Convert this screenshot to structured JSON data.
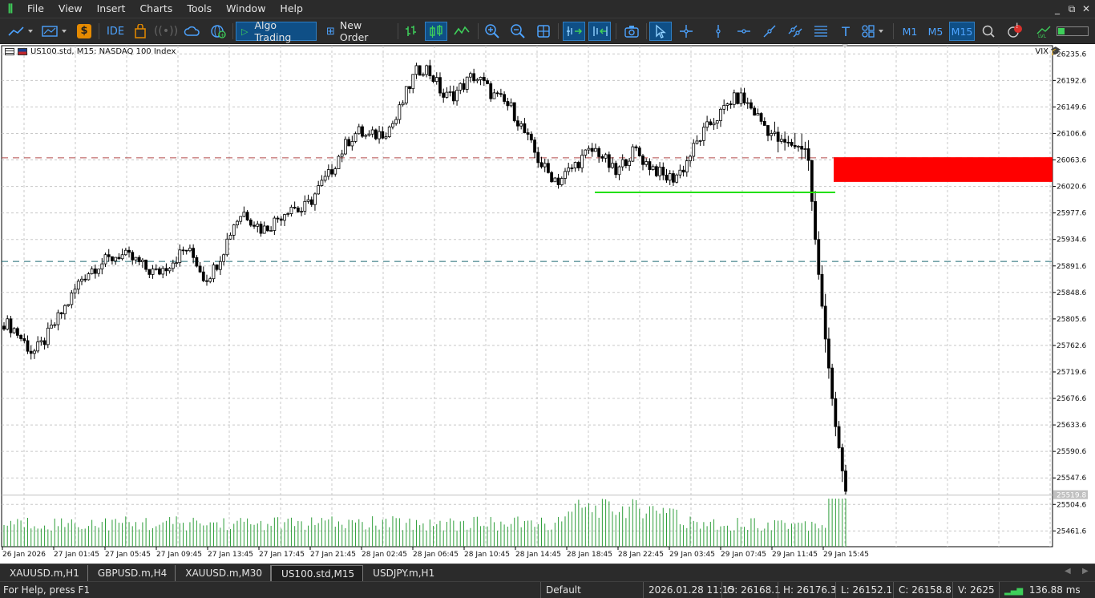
{
  "app": {
    "menu": [
      "File",
      "View",
      "Insert",
      "Charts",
      "Tools",
      "Window",
      "Help"
    ],
    "window_controls": [
      "_",
      "⧉",
      "✕"
    ]
  },
  "toolbar": {
    "ide_label": "IDE",
    "algo_trading_label": "Algo Trading",
    "new_order_label": "New Order",
    "timeframes": [
      "M1",
      "M5",
      "M15"
    ],
    "active_timeframe": "M15",
    "notification_badge": "!"
  },
  "chart_header": {
    "symbol_text": "US100.std, M15:  NASDAQ 100 Index",
    "vix_label": "VIX"
  },
  "chart_data": {
    "type": "candlestick",
    "symbol": "US100.std",
    "timeframe": "M15",
    "y_ticks": [
      "26235.6",
      "26192.6",
      "26149.6",
      "26106.6",
      "26063.6",
      "26020.6",
      "25977.6",
      "25934.6",
      "25891.6",
      "25848.6",
      "25805.6",
      "25762.6",
      "25719.6",
      "25676.6",
      "25633.6",
      "25590.6",
      "25547.6",
      "25504.6",
      "25461.6"
    ],
    "y_range": [
      25436,
      26249
    ],
    "price_tag": "25519.8",
    "x_ticks": [
      "26 Jan 2026",
      "27 Jan 01:45",
      "27 Jan 05:45",
      "27 Jan 09:45",
      "27 Jan 13:45",
      "27 Jan 17:45",
      "27 Jan 21:45",
      "28 Jan 02:45",
      "28 Jan 06:45",
      "28 Jan 10:45",
      "28 Jan 14:45",
      "28 Jan 18:45",
      "28 Jan 22:45",
      "29 Jan 03:45",
      "29 Jan 07:45",
      "29 Jan 11:45",
      "29 Jan 15:45"
    ],
    "price_path": [
      25800,
      25790,
      25770,
      25750,
      25765,
      25790,
      25815,
      25840,
      25870,
      25885,
      25895,
      25902,
      25910,
      25905,
      25898,
      25885,
      25880,
      25892,
      25905,
      25920,
      25902,
      25870,
      25888,
      25920,
      25960,
      25980,
      25965,
      25950,
      25960,
      25975,
      25990,
      25980,
      25995,
      26020,
      26040,
      26070,
      26095,
      26110,
      26100,
      26105,
      26112,
      26130,
      26170,
      26205,
      26215,
      26195,
      26165,
      26170,
      26185,
      26200,
      26190,
      26170,
      26160,
      26148,
      26120,
      26090,
      26060,
      26040,
      26030,
      26045,
      26060,
      26075,
      26080,
      26060,
      26040,
      26065,
      26080,
      26060,
      26050,
      26035,
      26035,
      26050,
      26080,
      26105,
      26125,
      26140,
      26160,
      26165,
      26150,
      26130,
      26110,
      26095,
      26090,
      26085,
      26082,
      25900,
      25760,
      25620,
      25525
    ],
    "dashed_levels": [
      {
        "value": 26067,
        "color": "#b34a4a"
      },
      {
        "value": 25899,
        "color": "#1e6b73"
      }
    ],
    "support_line": {
      "value": 26011,
      "color": "#22e000"
    },
    "resistance_zone": {
      "from": 26068,
      "to": 26028,
      "color": "#ff0000"
    },
    "volume_bar_color": "#2e9e3a"
  },
  "tabs": {
    "items": [
      "XAUUSD.m,H1",
      "GBPUSD.m,H4",
      "XAUUSD.m,M30",
      "US100.std,M15",
      "USDJPY.m,H1"
    ],
    "active": "US100.std,M15"
  },
  "statusbar": {
    "help": "For Help, press F1",
    "profile": "Default",
    "datetime": "2026.01.28 11:15",
    "open": "O: 26168.1",
    "high": "H: 26176.3",
    "low": "L: 26152.1",
    "close": "C: 26158.8",
    "volume": "V: 2625",
    "ping": "136.88 ms"
  }
}
